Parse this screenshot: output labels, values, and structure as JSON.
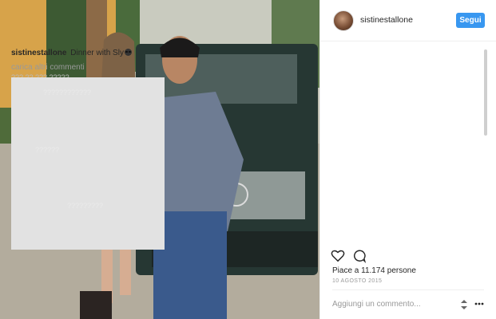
{
  "post": {
    "username": "sistinestallone",
    "follow_label": "Segui",
    "caption_user": "sistinestallone",
    "caption_text": "Dinner with Sly",
    "load_more_label": "carica altri commenti",
    "partial_comment": "??? ?? ??? ?????",
    "hidden_hints": [
      "????????????",
      "??????",
      "?????????"
    ],
    "likes_text": "Piace a 11.174 persone",
    "date_text": "10 AGOSTO 2015",
    "comment_placeholder": "Aggiungi un commento..."
  },
  "icons": {
    "caption_emoji": "sunglasses-emoji",
    "like": "heart-icon",
    "comment": "comment-bubble-icon",
    "sort": "up-down-arrows-icon",
    "more": "more-options-icon"
  },
  "colors": {
    "follow_button": "#3897f0",
    "redaction": "#e2e2e2",
    "secondary_text": "#999999"
  }
}
